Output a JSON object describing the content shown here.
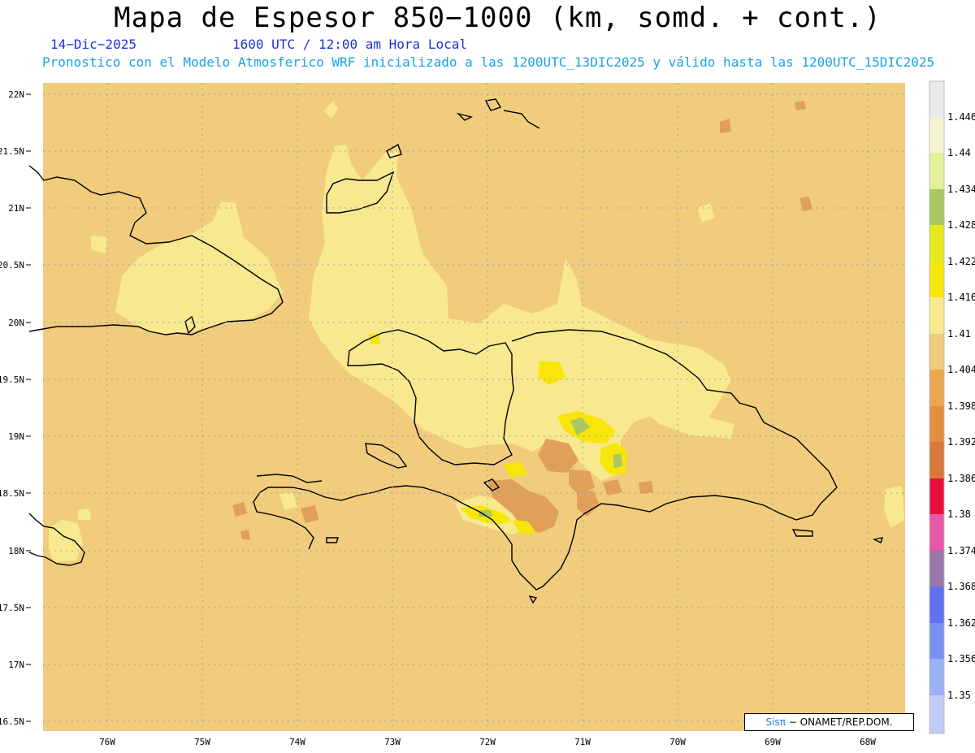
{
  "title": "Mapa de Espesor 850−1000 (km, somd. + cont.)",
  "date": "14−Dic−2025",
  "time": "1600 UTC / 12:00 am Hora Local",
  "description": "Pronostico con el Modelo Atmosferico WRF inicializado a las 1200UTC_13DIC2025 y válido hasta las  1200UTC_15DIC2025",
  "credit": {
    "logo": "Sisπ",
    "text": "− ONAMET/REP.DOM."
  },
  "lat_labels": [
    "22N",
    "21.5N",
    "21N",
    "20.5N",
    "20N",
    "19.5N",
    "19N",
    "18.5N",
    "18N",
    "17.5N",
    "17N",
    "16.5N"
  ],
  "lon_labels": [
    "76W",
    "75W",
    "74W",
    "73W",
    "72W",
    "71W",
    "70W",
    "69W",
    "68W"
  ],
  "colorbar": {
    "labels": [
      "1.446",
      "1.44",
      "1.434",
      "1.428",
      "1.422",
      "1.416",
      "1.41",
      "1.404",
      "1.398",
      "1.392",
      "1.386",
      "1.38",
      "1.374",
      "1.368",
      "1.362",
      "1.356",
      "1.35"
    ],
    "colors": [
      "#eaeaea",
      "#f2f4d4",
      "#e2f29a",
      "#a8c860",
      "#e6ea1e",
      "#f8e60a",
      "#f8e88e",
      "#f0cc7c",
      "#eaa84e",
      "#e48f3e",
      "#d8783a",
      "#e8103a",
      "#e858a8",
      "#9878a8",
      "#6070ee",
      "#7890f0",
      "#9cb0f6",
      "#c0ccf8"
    ]
  },
  "colors": {
    "background_field": "#f0cc7c",
    "high_field": "#f8e88e",
    "low_field": "#e0a05a",
    "coastline": "#000000",
    "grid": "#a0a0b4"
  }
}
